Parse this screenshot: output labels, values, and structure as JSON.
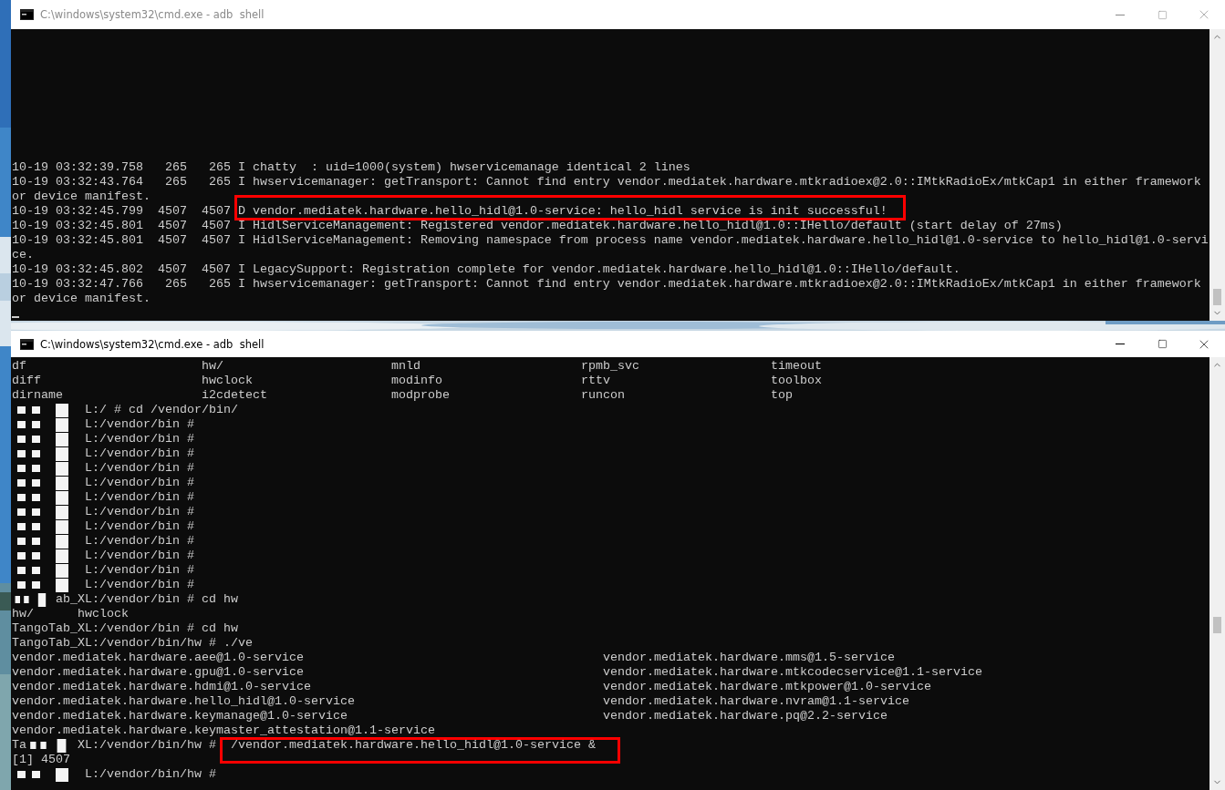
{
  "windows": [
    {
      "title": "C:\\windows\\system32\\cmd.exe - adb  shell",
      "active": false,
      "lines": [
        {
          "kind": "plain",
          "text": "10-19 03:32:39.758   265   265 I chatty  : uid=1000(system) hwservicemanage identical 2 lines"
        },
        {
          "kind": "plain",
          "text": "10-19 03:32:43.764   265   265 I hwservicemanager: getTransport: Cannot find entry vendor.mediatek.hardware.mtkradioex@2.0::IMtkRadioEx/mtkCap1 in either framework"
        },
        {
          "kind": "plain",
          "text": "or device manifest."
        },
        {
          "kind": "marked",
          "text": "10-19 03:32:45.799  4507  4507 ",
          "mark": "D vendor.mediatek.hardware.hello_hidl@1.0-service: hello_hidl service is init successful!"
        },
        {
          "kind": "plain",
          "text": "10-19 03:32:45.801  4507  4507 I HidlServiceManagement: Registered vendor.mediatek.hardware.hello_hidl@1.0::IHello/default (start delay of 27ms)"
        },
        {
          "kind": "plain",
          "text": "10-19 03:32:45.801  4507  4507 I HidlServiceManagement: Removing namespace from process name vendor.mediatek.hardware.hello_hidl@1.0-service to hello_hidl@1.0-servi"
        },
        {
          "kind": "plain",
          "text": "ce."
        },
        {
          "kind": "plain",
          "text": "10-19 03:32:45.802  4507  4507 I LegacySupport: Registration complete for vendor.mediatek.hardware.hello_hidl@1.0::IHello/default."
        },
        {
          "kind": "plain",
          "text": "10-19 03:32:47.766   265   265 I hwservicemanager: getTransport: Cannot find entry vendor.mediatek.hardware.mtkradioex@2.0::IMtkRadioEx/mtkCap1 in either framework"
        },
        {
          "kind": "plain",
          "text": "or device manifest."
        },
        {
          "kind": "cursor"
        }
      ]
    },
    {
      "title": "C:\\windows\\system32\\cmd.exe - adb  shell",
      "active": true,
      "lines": [
        {
          "kind": "columns",
          "cells": [
            "df",
            "hw/",
            "mnld",
            "rpmb_svc",
            "timeout"
          ]
        },
        {
          "kind": "columns",
          "cells": [
            "diff",
            "hwclock",
            "modinfo",
            "rttv",
            "toolbox"
          ]
        },
        {
          "kind": "columns",
          "cells": [
            "dirname",
            "i2cdetect",
            "modprobe",
            "runcon",
            "top"
          ]
        },
        {
          "kind": "redacted",
          "text": "L:/ # cd /vendor/bin/"
        },
        {
          "kind": "redacted",
          "text": "L:/vendor/bin #"
        },
        {
          "kind": "redacted",
          "text": "L:/vendor/bin #"
        },
        {
          "kind": "redacted",
          "text": "L:/vendor/bin #"
        },
        {
          "kind": "redacted",
          "text": "L:/vendor/bin #"
        },
        {
          "kind": "redacted",
          "text": "L:/vendor/bin #"
        },
        {
          "kind": "redacted",
          "text": "L:/vendor/bin #"
        },
        {
          "kind": "redacted",
          "text": "L:/vendor/bin #"
        },
        {
          "kind": "redacted",
          "text": "L:/vendor/bin #"
        },
        {
          "kind": "redacted",
          "text": "L:/vendor/bin #"
        },
        {
          "kind": "redacted",
          "text": "L:/vendor/bin #"
        },
        {
          "kind": "redacted",
          "text": "L:/vendor/bin #"
        },
        {
          "kind": "redacted",
          "text": "L:/vendor/bin #"
        },
        {
          "kind": "redacted_short",
          "text": "ab_XL:/vendor/bin # cd hw"
        },
        {
          "kind": "plain",
          "text": "hw/      hwclock"
        },
        {
          "kind": "plain",
          "text": "TangoTab_XL:/vendor/bin # cd hw"
        },
        {
          "kind": "plain",
          "text": "TangoTab_XL:/vendor/bin/hw # ./ve"
        },
        {
          "kind": "columns",
          "cells": [
            "vendor.mediatek.hardware.aee@1.0-service",
            "vendor.mediatek.hardware.mms@1.5-service"
          ]
        },
        {
          "kind": "columns",
          "cells": [
            "vendor.mediatek.hardware.gpu@1.0-service",
            "vendor.mediatek.hardware.mtkcodecservice@1.1-service"
          ]
        },
        {
          "kind": "columns",
          "cells": [
            "vendor.mediatek.hardware.hdmi@1.0-service",
            "vendor.mediatek.hardware.mtkpower@1.0-service"
          ]
        },
        {
          "kind": "columns",
          "cells": [
            "vendor.mediatek.hardware.hello_hidl@1.0-service",
            "vendor.mediatek.hardware.nvram@1.1-service"
          ]
        },
        {
          "kind": "columns",
          "cells": [
            "vendor.mediatek.hardware.keymanage@1.0-service",
            "vendor.mediatek.hardware.pq@2.2-service"
          ]
        },
        {
          "kind": "plain",
          "text": "vendor.mediatek.hardware.keymaster_attestation@1.1-service"
        },
        {
          "kind": "redacted_mid",
          "lead": "Ta",
          "text": "XL:/vendor/bin/hw # ",
          "mark": " /vendor.mediatek.hardware.hello_hidl@1.0-service &"
        },
        {
          "kind": "plain",
          "text": "[1] 4507"
        },
        {
          "kind": "redacted",
          "text": "L:/vendor/bin/hw #"
        }
      ]
    }
  ]
}
